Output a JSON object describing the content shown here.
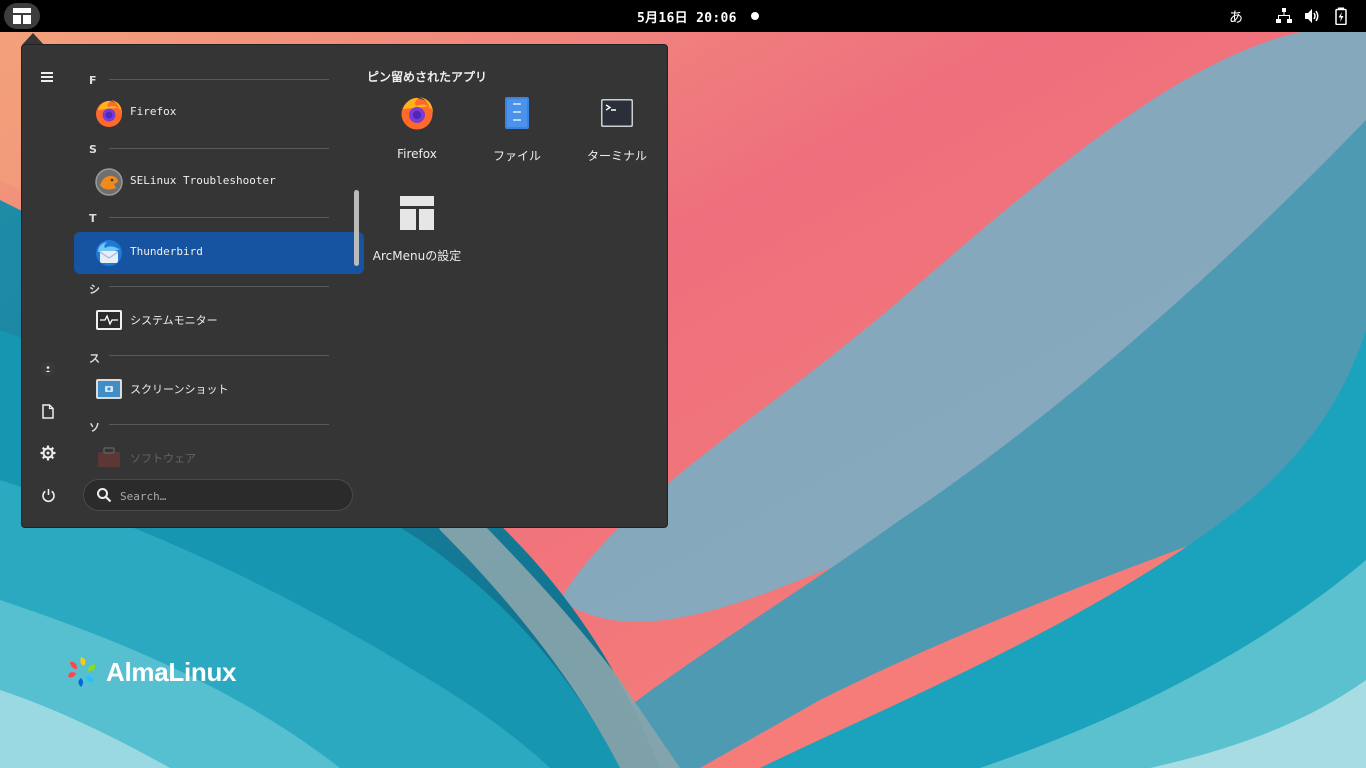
{
  "topbar": {
    "clock": "5月16日 20:06",
    "ime_indicator": "あ"
  },
  "menu": {
    "sections": [
      {
        "letter": "F",
        "apps": [
          {
            "label": "Firefox",
            "icon": "firefox-icon"
          }
        ]
      },
      {
        "letter": "S",
        "apps": [
          {
            "label": "SELinux Troubleshooter",
            "icon": "selinux-icon"
          }
        ]
      },
      {
        "letter": "T",
        "apps": [
          {
            "label": "Thunderbird",
            "icon": "thunderbird-icon",
            "selected": true
          }
        ]
      },
      {
        "letter": "シ",
        "apps": [
          {
            "label": "システムモニター",
            "icon": "system-monitor-icon"
          }
        ]
      },
      {
        "letter": "ス",
        "apps": [
          {
            "label": "スクリーンショット",
            "icon": "screenshot-icon"
          }
        ]
      },
      {
        "letter": "ソ",
        "apps": [
          {
            "label": "ソフトウェア",
            "icon": "software-icon"
          }
        ]
      }
    ],
    "search_placeholder": "Search…",
    "pinned_title": "ピン留めされたアプリ",
    "pinned": [
      {
        "label": "Firefox",
        "icon": "firefox-icon"
      },
      {
        "label": "ファイル",
        "icon": "files-icon"
      },
      {
        "label": "ターミナル",
        "icon": "terminal-icon"
      },
      {
        "label": "ArcMenuの設定",
        "icon": "arcmenu-settings-icon"
      }
    ],
    "side_icons": [
      "hamburger-icon",
      "user-avatar-icon",
      "documents-icon",
      "settings-gear-icon",
      "power-icon"
    ]
  },
  "desktop": {
    "logo_text": "AlmaLinux"
  },
  "colors": {
    "accent": "#1653a1",
    "menu_bg": "#353535",
    "topbar_bg": "#000000"
  }
}
